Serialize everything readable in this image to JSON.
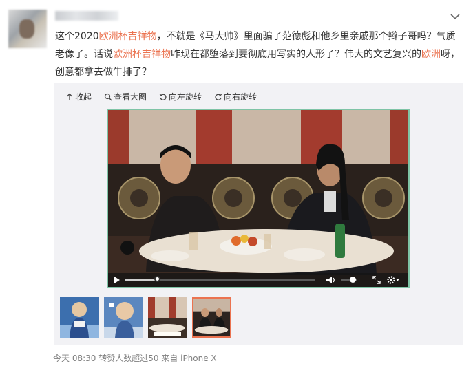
{
  "post": {
    "text_segments": [
      {
        "text": "这个2020",
        "highlight": false
      },
      {
        "text": "欧洲杯吉祥物",
        "highlight": true
      },
      {
        "text": "，不就是《马大帅》里面骗了范德彪和他乡里亲戚那个辫子哥吗？气质老像了。话说",
        "highlight": false
      },
      {
        "text": "欧洲杯吉祥物",
        "highlight": true
      },
      {
        "text": "咋现在都堕落到要彻底用写实的人形了？伟大的文艺复兴的",
        "highlight": false
      },
      {
        "text": "欧洲",
        "highlight": true
      },
      {
        "text": "呀，创意都拿去做牛排了？",
        "highlight": false
      }
    ]
  },
  "toolbar": {
    "collapse_label": "收起",
    "view_large_label": "查看大图",
    "rotate_left_label": "向左旋转",
    "rotate_right_label": "向右旋转"
  },
  "video": {
    "progress": 0.17,
    "volume": 0.7
  },
  "thumbnails": [
    {
      "scene": "mascot-stadium",
      "active": false
    },
    {
      "scene": "mascot-closeup",
      "active": false
    },
    {
      "scene": "dinner-table",
      "active": false
    },
    {
      "scene": "two-men-dining",
      "active": true
    }
  ],
  "footer": {
    "meta": "今天 08:30 转赞人数超过50 来自 iPhone X"
  },
  "colors": {
    "highlight": "#eb7350",
    "video_border": "#7fc4a6",
    "card_bg": "#f2f2f5",
    "meta_text": "#808080"
  }
}
